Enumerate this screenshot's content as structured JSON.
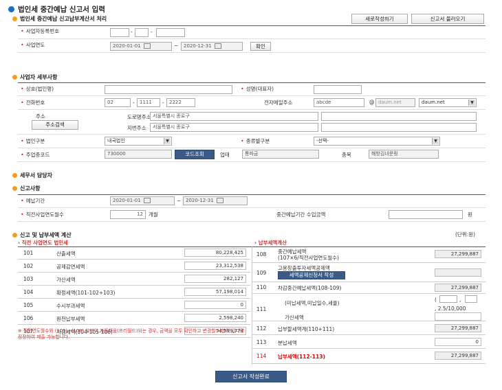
{
  "page_title": "법인세 중간예납 신고서 입력",
  "section1": {
    "title": "법인세 중간예납 신고납부계산서 처리",
    "btn_new": "새로작성하기",
    "btn_load": "신고서 불러오기"
  },
  "biz_reg": {
    "label": "사업자등록번호",
    "sep": "-"
  },
  "biz_year": {
    "label": "사업연도",
    "from": "2020-01-01",
    "to": "2020-12-31",
    "tilde": "~",
    "confirm": "확인"
  },
  "section2": {
    "title": "사업자 세부사항"
  },
  "corp_name": {
    "label": "상호(법인명)"
  },
  "rep_name": {
    "label": "성명(대표자)"
  },
  "phone": {
    "label": "전화번호",
    "p1": "02",
    "p2": "1111",
    "p3": "2222",
    "sep": "-"
  },
  "email": {
    "label": "전자메일주소",
    "id": "abcde",
    "at": "@",
    "domain": "daum.net",
    "domain_select": "daum.net"
  },
  "address": {
    "label": "주소",
    "search": "주소검색",
    "road_label": "도로명주소",
    "road_val": "서울특별시 종로구",
    "jibun_label": "지번주소",
    "jibun_val": "서울특별시 종로구"
  },
  "corp_type": {
    "label": "법인구분",
    "value": "내국법인"
  },
  "kind_type": {
    "label": "종류별구분",
    "value": "-선택-"
  },
  "industry": {
    "label": "주업종코드",
    "code": "730000",
    "search_btn": "코드조회",
    "type_label": "업태",
    "type_val": "통파금",
    "item_label": "종목",
    "item_val": "해방김녀문링"
  },
  "section3": {
    "title": "세무서 담당자"
  },
  "section4": {
    "title": "신고사항"
  },
  "prepay_period": {
    "label": "예납기간",
    "from": "2020-01-01",
    "to": "2020-12-31",
    "tilde": "~"
  },
  "prev_months": {
    "label": "직전사업연도월수",
    "value": "12",
    "unit": "개월"
  },
  "income": {
    "label": "중간예납기간 수입금액",
    "unit": "원"
  },
  "section5": {
    "title": "신고 및 납부세액 계산",
    "unit_note": "(단위:원)",
    "left_sub": "직전 사업연도 법인세",
    "right_sub": "납부세액계산"
  },
  "left_rows": [
    {
      "no": "101",
      "label": "산출세액",
      "value": "80,228,425"
    },
    {
      "no": "102",
      "label": "공제감면세액",
      "value": "23,312,538"
    },
    {
      "no": "103",
      "label": "가산세액",
      "value": "282,127"
    },
    {
      "no": "104",
      "label": "확정세액(101-102+103)",
      "value": "57,198,014"
    },
    {
      "no": "105",
      "label": "수시부과세액",
      "value": "0"
    },
    {
      "no": "106",
      "label": "원천납부세액",
      "value": "2,598,240"
    },
    {
      "no": "107",
      "label": "차감세액(104-105-106)",
      "value": "54,599,774"
    }
  ],
  "right_rows": {
    "r108": {
      "no": "108",
      "label1": "중간예납세액",
      "label2": "(107×6/직전사업연도월수)",
      "value": "27,299,887"
    },
    "r109": {
      "no": "109",
      "label": "고용창출투자세액공제액",
      "btn": "세액공제신청서 작성",
      "value": ""
    },
    "r110": {
      "no": "110",
      "label": "차감중간예납세액(108-109)",
      "value": "27,299,887"
    },
    "r111": {
      "no": "111",
      "label": "(미납세액,미납일수,세율)",
      "note": ", 2.5/10,000",
      "label2": "가산세액"
    },
    "r112": {
      "no": "112",
      "label": "납부할세액계(110+111)",
      "value": "27,299,887"
    },
    "r113": {
      "no": "113",
      "label": "분납세액",
      "value": "0"
    },
    "r114": {
      "no": "114",
      "label": "납부세액(112-113)",
      "value": "27,299,887"
    }
  },
  "footnote": "※ 직전연도월수와 (101)~(108) 부분이 자동채움(프리필드)되는 경우, 금액을 모두 확인하고 변경할 사항이 있다면 정정하여 제출 가능합니다.",
  "submit": "신고서 작성완료"
}
